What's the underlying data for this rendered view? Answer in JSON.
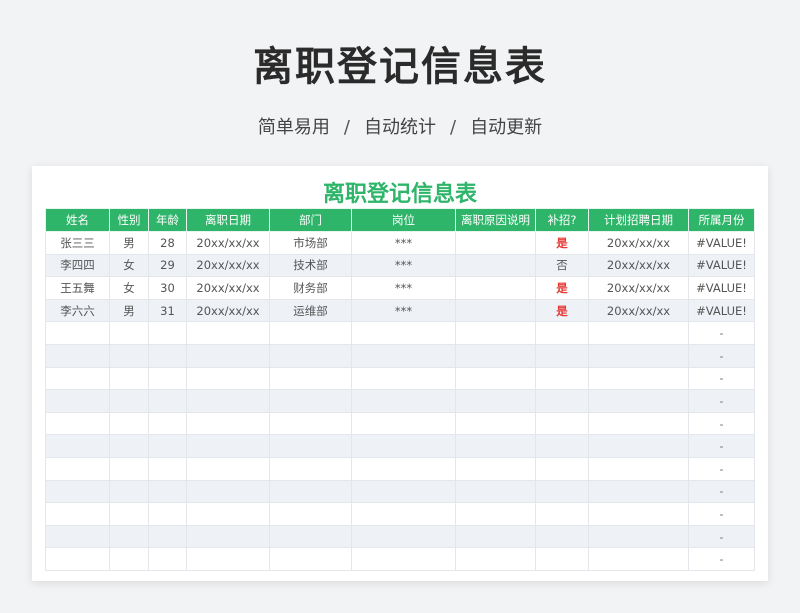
{
  "page": {
    "title": "离职登记信息表",
    "subtitle": [
      "简单易用",
      "自动统计",
      "自动更新"
    ],
    "separator": "/"
  },
  "sheet": {
    "title": "离职登记信息表",
    "accent_color": "#2eb56a",
    "headers": [
      "姓名",
      "性别",
      "年龄",
      "离职日期",
      "部门",
      "岗位",
      "离职原因说明",
      "补招?",
      "计划招聘日期",
      "所属月份"
    ],
    "rows": [
      {
        "name": "张三三",
        "gender": "男",
        "age": "28",
        "leave_date": "20xx/xx/xx",
        "dept": "市场部",
        "position": "***",
        "reason": "",
        "rehire": "是",
        "plan_date": "20xx/xx/xx",
        "month": "#VALUE!"
      },
      {
        "name": "李四四",
        "gender": "女",
        "age": "29",
        "leave_date": "20xx/xx/xx",
        "dept": "技术部",
        "position": "***",
        "reason": "",
        "rehire": "否",
        "plan_date": "20xx/xx/xx",
        "month": "#VALUE!"
      },
      {
        "name": "王五舞",
        "gender": "女",
        "age": "30",
        "leave_date": "20xx/xx/xx",
        "dept": "财务部",
        "position": "***",
        "reason": "",
        "rehire": "是",
        "plan_date": "20xx/xx/xx",
        "month": "#VALUE!"
      },
      {
        "name": "李六六",
        "gender": "男",
        "age": "31",
        "leave_date": "20xx/xx/xx",
        "dept": "运维部",
        "position": "***",
        "reason": "",
        "rehire": "是",
        "plan_date": "20xx/xx/xx",
        "month": "#VALUE!"
      }
    ],
    "empty_rows": 11,
    "empty_month_value": "-"
  }
}
